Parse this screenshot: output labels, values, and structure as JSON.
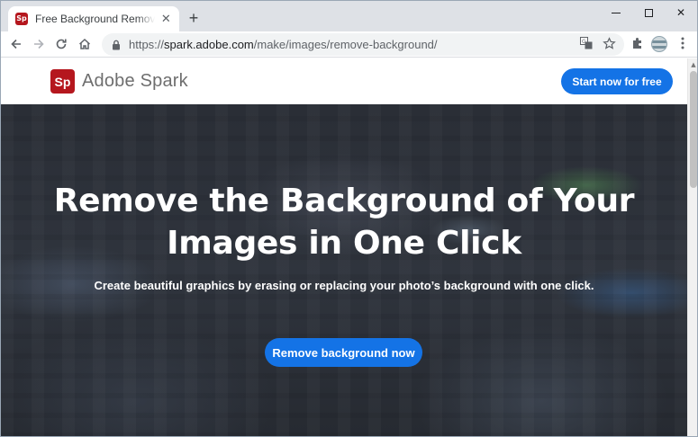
{
  "browser": {
    "tab": {
      "title": "Free Background Remover: Remove Backgrounds from Images | Adobe Spark",
      "favicon_glyph": "Sp"
    },
    "omnibox": {
      "url_scheme": "https://",
      "url_host": "spark.adobe.com",
      "url_path": "/make/images/remove-background/"
    },
    "icons": {
      "back": "arrow-left-icon",
      "forward": "arrow-right-icon",
      "reload": "reload-icon",
      "home": "home-icon",
      "lock": "lock-icon",
      "translate": "translate-icon",
      "bookmark": "star-icon",
      "extensions": "puzzle-icon",
      "menu": "kebab-menu-icon"
    }
  },
  "site": {
    "logo_badge": "Sp",
    "brand_name": "Adobe Spark",
    "header_cta": "Start now for free",
    "accent_color": "#1473e6",
    "brand_color": "#b5171e"
  },
  "hero": {
    "title_line1": "Remove the Background of Your",
    "title_line2": "Images in One Click",
    "subtitle": "Create beautiful graphics by erasing or replacing your photo’s background with one click.",
    "cta": "Remove background now"
  }
}
